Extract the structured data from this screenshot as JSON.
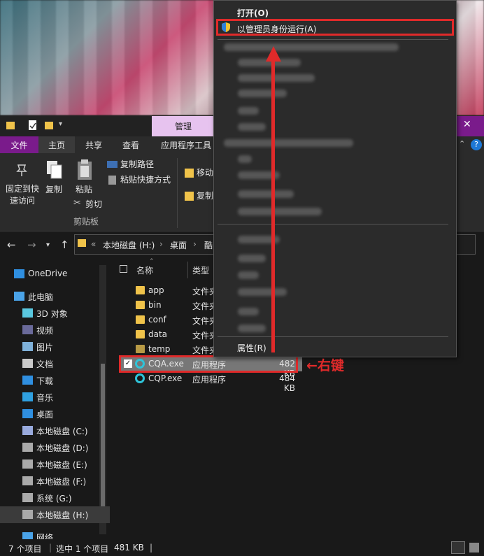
{
  "window": {
    "manage_tab": "管理",
    "ribbon_tabs": [
      "文件",
      "主页",
      "共享",
      "查看",
      "应用程序工具"
    ]
  },
  "ribbon": {
    "pin": "固定到快\n速访问",
    "pin_line1": "固定到快",
    "pin_line2": "速访问",
    "copy": "复制",
    "paste": "粘贴",
    "copy_path": "复制路径",
    "paste_shortcut": "粘贴快捷方式",
    "cut": "剪切",
    "clipboard_group": "剪贴板",
    "move_to": "移动",
    "copy_to": "复制"
  },
  "address": {
    "prefix": "«",
    "crumbs": [
      "本地磁盘 (H:)",
      "桌面",
      "酷"
    ]
  },
  "nav": {
    "items": [
      {
        "label": "OneDrive",
        "icon": "cloud-icon"
      },
      {
        "label": "此电脑",
        "icon": "computer-icon"
      },
      {
        "label": "3D 对象",
        "icon": "cube-icon"
      },
      {
        "label": "视频",
        "icon": "video-icon"
      },
      {
        "label": "图片",
        "icon": "picture-icon"
      },
      {
        "label": "文档",
        "icon": "document-icon"
      },
      {
        "label": "下载",
        "icon": "download-icon"
      },
      {
        "label": "音乐",
        "icon": "music-icon"
      },
      {
        "label": "桌面",
        "icon": "desktop-icon"
      },
      {
        "label": "本地磁盘 (C:)",
        "icon": "drive-c-icon"
      },
      {
        "label": "本地磁盘 (D:)",
        "icon": "drive-icon"
      },
      {
        "label": "本地磁盘 (E:)",
        "icon": "drive-icon"
      },
      {
        "label": "本地磁盘 (F:)",
        "icon": "drive-icon"
      },
      {
        "label": "系统 (G:)",
        "icon": "drive-icon"
      },
      {
        "label": "本地磁盘 (H:)",
        "icon": "drive-icon"
      },
      {
        "label": "网络",
        "icon": "network-icon"
      }
    ]
  },
  "list": {
    "col_name": "名称",
    "col_type": "类型",
    "rows": [
      {
        "name": "app",
        "type": "文件夹",
        "size": ""
      },
      {
        "name": "bin",
        "type": "文件夹",
        "size": ""
      },
      {
        "name": "conf",
        "type": "文件夹",
        "size": ""
      },
      {
        "name": "data",
        "type": "文件夹",
        "size": ""
      },
      {
        "name": "temp",
        "type": "文件夹",
        "size": ""
      },
      {
        "name": "CQA.exe",
        "type": "应用程序",
        "size": "482 KB"
      },
      {
        "name": "CQP.exe",
        "type": "应用程序",
        "size": "484 KB"
      }
    ]
  },
  "context_menu": {
    "open": "打开(O)",
    "run_as_admin": "以管理员身份运行(A)",
    "properties": "属性(R)"
  },
  "annotation": "←右键",
  "status": {
    "count": "7 个项目",
    "selected": "选中 1 个项目",
    "size": "481 KB"
  },
  "colors": {
    "accent_purple": "#7a1b8b",
    "highlight_red": "#e02a2a",
    "folder_yellow": "#f0c34a"
  }
}
